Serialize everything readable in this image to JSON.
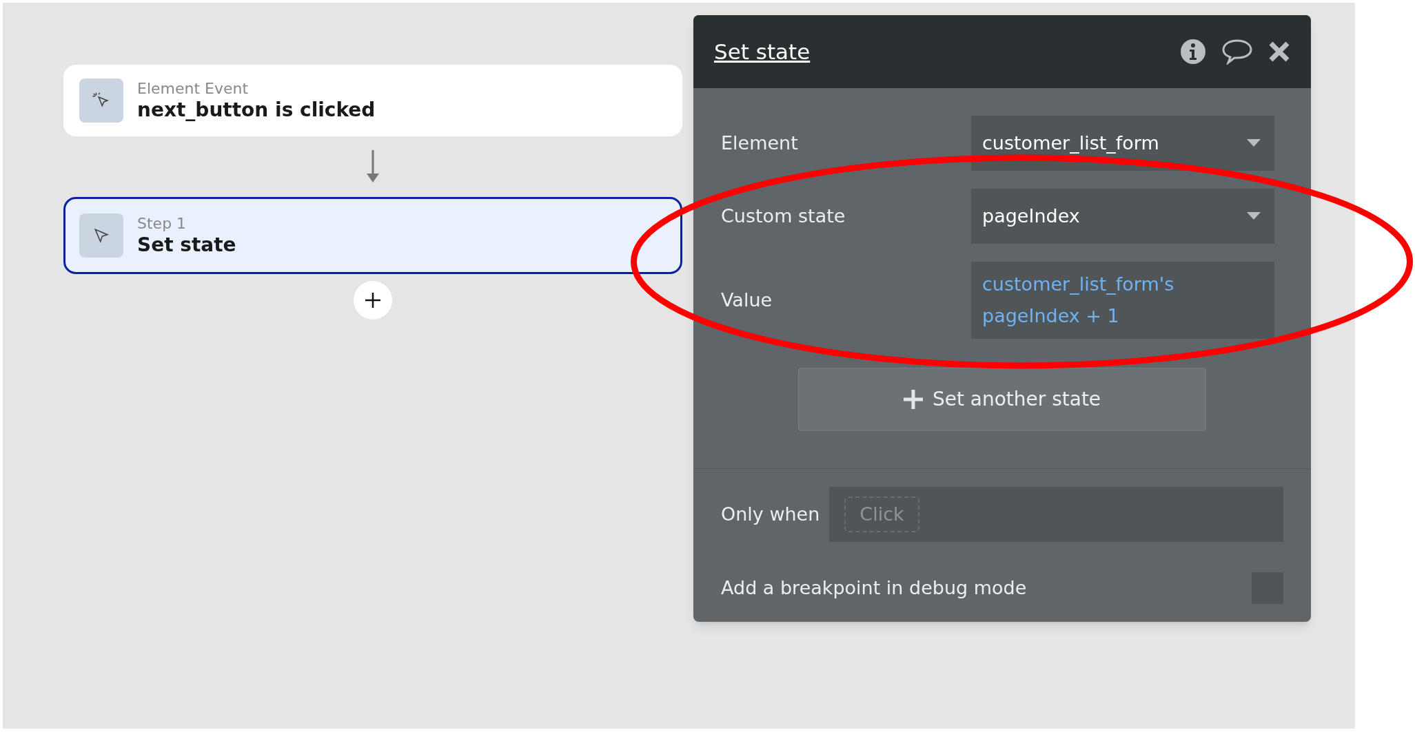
{
  "workflow": {
    "cards": [
      {
        "label": "Element Event",
        "title": "next_button is clicked",
        "kind": "event",
        "selected": false
      },
      {
        "label": "Step 1",
        "title": "Set state",
        "kind": "action",
        "selected": true
      }
    ]
  },
  "panel": {
    "title": "Set state",
    "fields": [
      {
        "kind": "dropdown",
        "label": "Element",
        "value": "customer_list_form"
      },
      {
        "kind": "dropdown",
        "label": "Custom state",
        "value": "pageIndex"
      },
      {
        "kind": "expression",
        "label": "Value",
        "value": "customer_list_form's pageIndex + 1"
      }
    ],
    "add_button": {
      "label": "Set another state"
    },
    "condition": {
      "label": "Only when",
      "placeholder": "Click"
    },
    "breakpoint": {
      "label": "Add a breakpoint in debug mode",
      "checked": false
    }
  }
}
